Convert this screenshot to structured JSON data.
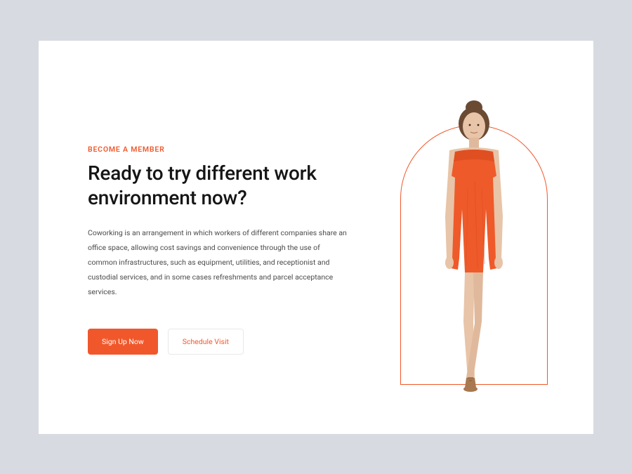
{
  "hero": {
    "eyebrow": "BECOME A MEMBER",
    "headline": "Ready to try different work environment now?",
    "body": "Coworking is an arrangement in which workers of different companies share an office space, allowing cost savings and convenience through the use of common infrastructures, such as equipment, utilities, and receptionist and custodial services, and in some cases refreshments and parcel acceptance services.",
    "primary_cta": "Sign Up Now",
    "secondary_cta": "Schedule Visit"
  },
  "colors": {
    "accent": "#f0582b",
    "page_bg": "#d7dae0",
    "card_bg": "#ffffff"
  },
  "image": {
    "description": "woman-in-orange-dress",
    "frame_shape": "arch"
  }
}
